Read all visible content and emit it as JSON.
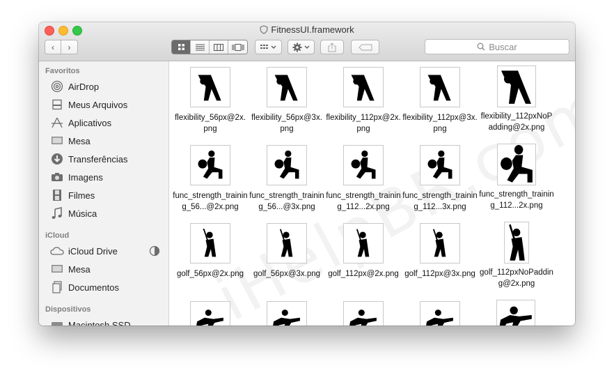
{
  "window": {
    "title": "FitnessUI.framework"
  },
  "toolbar": {
    "search_placeholder": "Buscar"
  },
  "sidebar": {
    "sections": [
      {
        "title": "Favoritos",
        "items": [
          {
            "label": "AirDrop",
            "icon": "airdrop-icon"
          },
          {
            "label": "Meus Arquivos",
            "icon": "documents-icon"
          },
          {
            "label": "Aplicativos",
            "icon": "applications-icon"
          },
          {
            "label": "Mesa",
            "icon": "desktop-icon"
          },
          {
            "label": "Transferências",
            "icon": "downloads-icon"
          },
          {
            "label": "Imagens",
            "icon": "camera-icon"
          },
          {
            "label": "Filmes",
            "icon": "film-icon"
          },
          {
            "label": "Música",
            "icon": "music-icon"
          }
        ]
      },
      {
        "title": "iCloud",
        "items": [
          {
            "label": "iCloud Drive",
            "icon": "cloud-icon"
          },
          {
            "label": "Mesa",
            "icon": "desktop-icon"
          },
          {
            "label": "Documentos",
            "icon": "documents-icon"
          }
        ]
      },
      {
        "title": "Dispositivos",
        "items": [
          {
            "label": "Macintosh SSD",
            "icon": "disk-icon"
          }
        ]
      }
    ]
  },
  "files": [
    {
      "name": "flexibility_56px@2x.png",
      "icon": "flexibility"
    },
    {
      "name": "flexibility_56px@3x.png",
      "icon": "flexibility"
    },
    {
      "name": "flexibility_112px@2x.png",
      "icon": "flexibility"
    },
    {
      "name": "flexibility_112px@3x.png",
      "icon": "flexibility"
    },
    {
      "name": "flexibility_112pxNoPadding@2x.png",
      "icon": "flexibility"
    },
    {
      "name": "func_strength_training_56...@2x.png",
      "icon": "strength"
    },
    {
      "name": "func_strength_training_56...@3x.png",
      "icon": "strength"
    },
    {
      "name": "func_strength_training_112...2x.png",
      "icon": "strength"
    },
    {
      "name": "func_strength_training_112...3x.png",
      "icon": "strength"
    },
    {
      "name": "func_strength_training_112...2x.png",
      "icon": "strength"
    },
    {
      "name": "golf_56px@2x.png",
      "icon": "golf"
    },
    {
      "name": "golf_56px@3x.png",
      "icon": "golf"
    },
    {
      "name": "golf_112px@2x.png",
      "icon": "golf"
    },
    {
      "name": "golf_112px@3x.png",
      "icon": "golf"
    },
    {
      "name": "golf_112pxNoPadding@2x.png",
      "icon": "golf"
    }
  ]
}
